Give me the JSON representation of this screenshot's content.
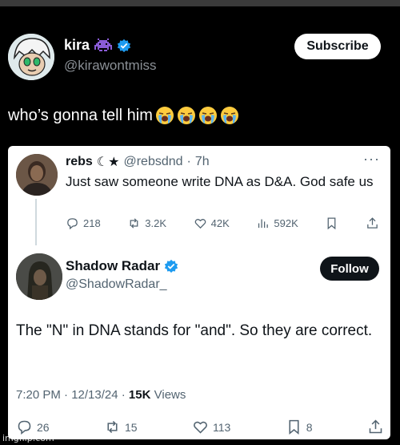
{
  "outer_post": {
    "name": "kira",
    "handle": "@kirawontmiss",
    "subscribe_label": "Subscribe",
    "text": "who’s gonna tell him",
    "emoji_count": 4,
    "name_emoji_icon": "alien-monster-icon",
    "badge_color": "#1d9bf0"
  },
  "quoted": {
    "reply": {
      "name": "rebs",
      "name_suffix": "☾★",
      "handle": "@rebsdnd",
      "time": "7h",
      "text": "Just saw someone write DNA as D&A. God safe us",
      "more": "···",
      "stats": {
        "replies": "218",
        "reposts": "3.2K",
        "likes": "42K",
        "views": "592K"
      }
    },
    "main": {
      "name": "Shadow Radar",
      "handle": "@ShadowRadar_",
      "follow_label": "Follow",
      "text": "The \"N\" in DNA stands for \"and\". So they are correct.",
      "datetime": "7:20 PM · 12/13/24 · ",
      "views_count": "15K",
      "views_label": "Views",
      "stats": {
        "replies": "26",
        "reposts": "15",
        "likes": "113",
        "bookmarks": "8"
      }
    }
  },
  "watermark": "imgflip.com"
}
